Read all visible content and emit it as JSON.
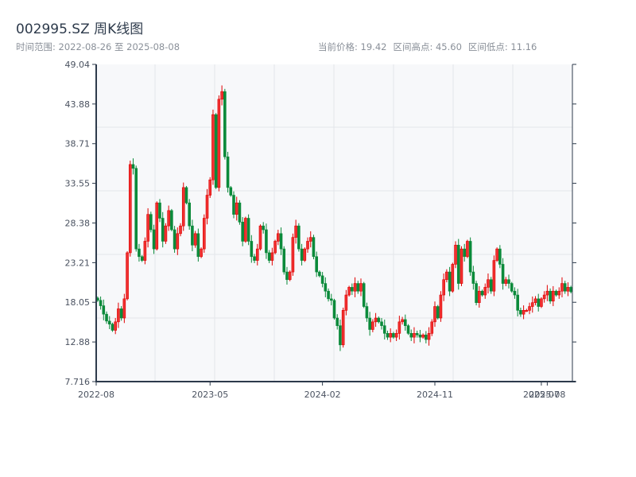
{
  "header": {
    "title": "002995.SZ 周K线图",
    "range_label": "时间范围: 2022-08-26 至 2025-08-08",
    "current_price": "当前价格: 19.42",
    "high": "区间高点: 45.60",
    "low": "区间低点: 11.16"
  },
  "colors": {
    "up": "#e00000",
    "down": "#0a8a3a",
    "axis": "#2d3a4b",
    "grid": "#e3e6ea",
    "plot_bg": "#f7f8fa"
  },
  "chart_data": {
    "type": "candlestick",
    "title": "002995.SZ 周K线图",
    "xlabel": "",
    "ylabel": "",
    "ylim": [
      7.716,
      49.04
    ],
    "yticks": [
      "7.716",
      "12.88",
      "18.05",
      "23.21",
      "28.38",
      "33.55",
      "38.71",
      "43.88",
      "49.04"
    ],
    "xticks": [
      {
        "label": "2022-08",
        "index": 0
      },
      {
        "label": "2023-05",
        "index": 38
      },
      {
        "label": "2024-02",
        "index": 76
      },
      {
        "label": "2024-11",
        "index": 114
      },
      {
        "label": "2025-07",
        "index": 150
      },
      {
        "label": "2025-08",
        "index": 152
      }
    ],
    "start_open": 18.6,
    "closes": [
      18.3,
      17.6,
      16.5,
      15.6,
      15.2,
      14.4,
      15.5,
      17.2,
      16.0,
      18.5,
      24.5,
      36.0,
      35.5,
      25.0,
      24.0,
      23.5,
      26.0,
      29.5,
      27.5,
      25.0,
      31.0,
      29.0,
      26.0,
      28.0,
      30.0,
      27.5,
      25.0,
      27.0,
      28.0,
      33.0,
      31.0,
      28.0,
      25.5,
      27.0,
      24.0,
      25.0,
      29.0,
      32.0,
      34.0,
      42.5,
      33.0,
      44.5,
      45.5,
      37.0,
      33.0,
      32.0,
      29.5,
      31.0,
      28.5,
      26.0,
      29.0,
      26.0,
      24.0,
      23.5,
      25.0,
      28.0,
      27.5,
      24.5,
      23.5,
      24.5,
      26.0,
      27.0,
      25.0,
      22.0,
      21.0,
      22.0,
      26.5,
      28.0,
      25.0,
      23.5,
      25.0,
      26.0,
      26.5,
      24.0,
      22.0,
      21.5,
      20.5,
      19.5,
      18.5,
      18.3,
      16.0,
      15.0,
      12.5,
      17.0,
      19.0,
      20.0,
      19.5,
      20.5,
      19.5,
      20.5,
      17.5,
      16.0,
      14.5,
      15.5,
      16.0,
      15.5,
      15.0,
      14.0,
      13.5,
      14.0,
      13.5,
      14.0,
      15.5,
      15.8,
      15.0,
      14.0,
      13.5,
      14.0,
      13.8,
      13.5,
      13.8,
      13.2,
      14.0,
      15.5,
      17.5,
      16.0,
      19.0,
      21.0,
      22.0,
      19.5,
      23.0,
      25.5,
      20.5,
      25.0,
      24.0,
      26.0,
      22.0,
      20.5,
      18.0,
      19.5,
      19.0,
      20.0,
      21.0,
      19.5,
      23.5,
      25.0,
      23.0,
      20.5,
      21.0,
      20.5,
      19.5,
      19.0,
      17.0,
      16.5,
      17.0,
      17.0,
      17.5,
      18.0,
      18.5,
      17.5,
      18.5,
      19.0,
      19.5,
      18.2,
      19.5,
      19.0,
      19.5,
      20.5,
      19.5,
      20.0,
      19.42
    ]
  }
}
